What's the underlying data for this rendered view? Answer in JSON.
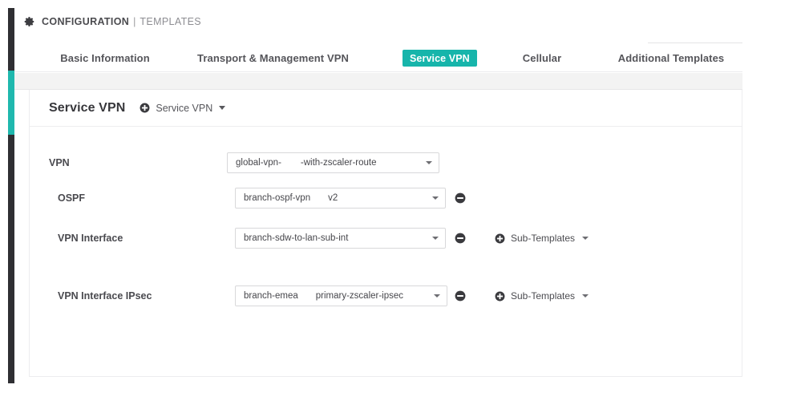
{
  "colors": {
    "accent_teal": "#17b5ab",
    "rail_dark": "#2f2f33",
    "band_grey": "#f3f3f3",
    "text_dark": "#37373b",
    "border_grey": "#ededef"
  },
  "header": {
    "gear_icon": "gear-icon",
    "main": "CONFIGURATION",
    "separator": "|",
    "sub": "TEMPLATES"
  },
  "tabs": [
    {
      "label": "Basic Information",
      "active": false
    },
    {
      "label": "Transport & Management VPN",
      "active": false
    },
    {
      "label": "Service VPN",
      "active": true
    },
    {
      "label": "Cellular",
      "active": false
    },
    {
      "label": "Additional Templates",
      "active": false
    }
  ],
  "section": {
    "title": "Service VPN",
    "add_icon": "plus-circle-icon",
    "add_label": "Service VPN",
    "add_caret": "chevron-down-icon"
  },
  "rows": [
    {
      "label": "VPN",
      "indent": 0,
      "select": {
        "value_left": "global-vpn-",
        "value_right": "-with-zscaler-route"
      },
      "removable": false,
      "sub_templates": false
    },
    {
      "label": "OSPF",
      "indent": 1,
      "select": {
        "value_left": "branch-ospf-vpn",
        "value_right": "v2"
      },
      "removable": true,
      "sub_templates": false
    },
    {
      "label": "VPN Interface",
      "indent": 1,
      "select": {
        "value_left": "branch-sdw-to-lan-sub-int",
        "value_right": ""
      },
      "removable": true,
      "sub_templates": true
    },
    {
      "label": "VPN Interface IPsec",
      "indent": 1,
      "select": {
        "value_left": "branch-emea",
        "value_right": "primary-zscaler-ipsec"
      },
      "removable": true,
      "sub_templates": true
    }
  ],
  "icons": {
    "remove": "minus-circle-icon",
    "sub_templates_add": "plus-circle-icon",
    "dropdown_caret": "chevron-down-icon"
  },
  "sub_templates": {
    "label": "Sub-Templates"
  }
}
